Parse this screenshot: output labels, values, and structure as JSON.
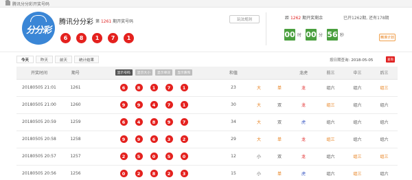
{
  "breadcrumb": {
    "home_icon": "home-icon",
    "items": [
      "腾讯分分彩开奖号码"
    ]
  },
  "lottery": {
    "logo_text": "分分彩",
    "name": "腾讯分分彩",
    "issue_prefix": "第",
    "issue_no": "1261",
    "issue_suffix": "期开奖号码",
    "history_btn": "玩法规则",
    "numbers": [
      "6",
      "8",
      "1",
      "7",
      "1"
    ]
  },
  "countdown": {
    "label_prefix": "距",
    "issue_no": "1262",
    "label_suffix": "期开奖剩余",
    "hours": "00",
    "hour_unit": "时",
    "minutes": "00",
    "minute_unit": "分",
    "seconds": "56",
    "second_unit": "秒",
    "stats": "已开1262期, 还有178期",
    "plan_btn": "精准计划"
  },
  "tabs": [
    "今天",
    "昨天",
    "前天",
    "统计结果"
  ],
  "date_query": {
    "label": "按日期查询:",
    "value": "2018-05-05",
    "button": "查询"
  },
  "table": {
    "headers": [
      "开奖时间",
      "期号",
      "",
      "和值",
      "",
      "",
      "龙虎",
      "前三",
      "中三",
      "后三"
    ],
    "display_buttons": [
      "显示号码",
      "显示大小",
      "显示单双",
      "显示质和"
    ],
    "rows": [
      {
        "time": "20180505 21:01",
        "issue": "1261",
        "nums": [
          "6",
          "8",
          "1",
          "7",
          "1"
        ],
        "sum": "23",
        "size": "大",
        "parity": "单",
        "dt": "龙",
        "q3": "组六",
        "z3": "组六",
        "h3": "组三"
      },
      {
        "time": "20180505 21:00",
        "issue": "1260",
        "nums": [
          "9",
          "9",
          "4",
          "7",
          "1"
        ],
        "sum": "30",
        "size": "大",
        "parity": "双",
        "dt": "龙",
        "q3": "组三",
        "z3": "组六",
        "h3": "组六"
      },
      {
        "time": "20180505 20:59",
        "issue": "1259",
        "nums": [
          "6",
          "4",
          "8",
          "9",
          "7"
        ],
        "sum": "34",
        "size": "大",
        "parity": "双",
        "dt": "虎",
        "q3": "组六",
        "z3": "组六",
        "h3": "组六"
      },
      {
        "time": "20180505 20:58",
        "issue": "1258",
        "nums": [
          "9",
          "9",
          "6",
          "3",
          "2"
        ],
        "sum": "29",
        "size": "大",
        "parity": "单",
        "dt": "龙",
        "q3": "组三",
        "z3": "组六",
        "h3": "组六"
      },
      {
        "time": "20180505 20:57",
        "issue": "1257",
        "nums": [
          "2",
          "5",
          "0",
          "5",
          "0"
        ],
        "sum": "12",
        "size": "小",
        "parity": "双",
        "dt": "龙",
        "q3": "组六",
        "z3": "组三",
        "h3": "组三"
      },
      {
        "time": "20180505 20:56",
        "issue": "1256",
        "nums": [
          "0",
          "2",
          "8",
          "2",
          "3"
        ],
        "sum": "15",
        "size": "小",
        "parity": "单",
        "dt": "虎",
        "q3": "组六",
        "z3": "组三",
        "h3": "组六"
      }
    ]
  }
}
